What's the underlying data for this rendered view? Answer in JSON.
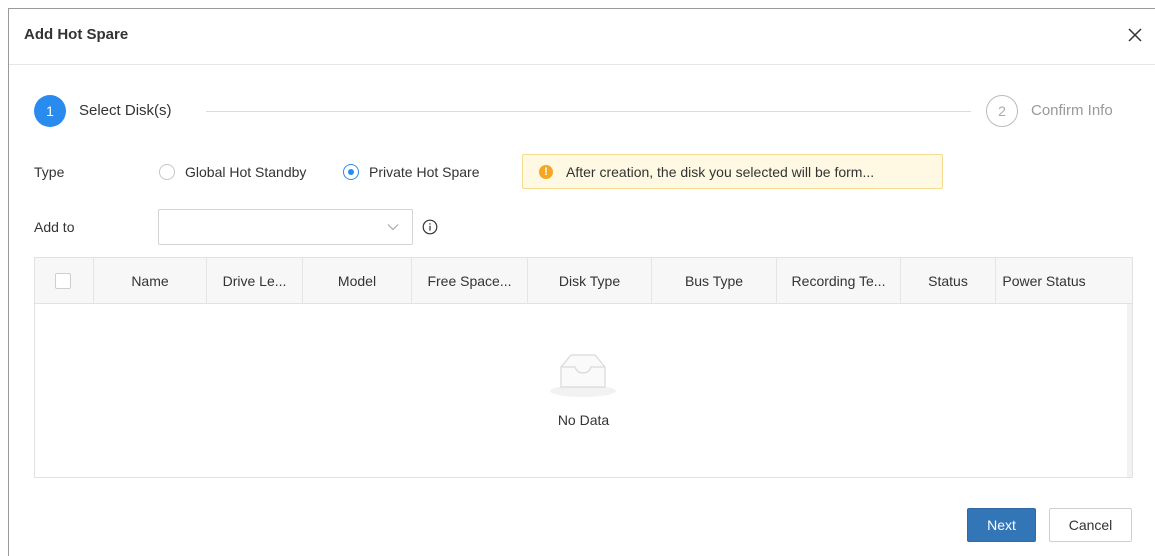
{
  "dialog": {
    "title": "Add Hot Spare",
    "close_icon": "close-icon"
  },
  "steps": [
    {
      "number": "1",
      "label": "Select Disk(s)",
      "state": "active"
    },
    {
      "number": "2",
      "label": "Confirm Info",
      "state": "pending"
    }
  ],
  "form": {
    "type_label": "Type",
    "type_options": [
      {
        "label": "Global Hot Standby",
        "checked": false
      },
      {
        "label": "Private Hot Spare",
        "checked": true
      }
    ],
    "notice": {
      "icon": "warning-icon",
      "text": "After creation, the disk you selected will be form..."
    },
    "add_to_label": "Add to",
    "add_to_value": "",
    "info_icon": "info-icon"
  },
  "table": {
    "columns": [
      "Name",
      "Drive Le...",
      "Model",
      "Free Space...",
      "Disk Type",
      "Bus Type",
      "Recording Te...",
      "Status",
      "Power Status"
    ],
    "rows": [],
    "empty_text": "No Data"
  },
  "footer": {
    "next_label": "Next",
    "cancel_label": "Cancel"
  },
  "colors": {
    "accent": "#2a8bef",
    "primary_button": "#3376b8",
    "notice_bg": "#fff9e3",
    "warning": "#f5a623"
  }
}
